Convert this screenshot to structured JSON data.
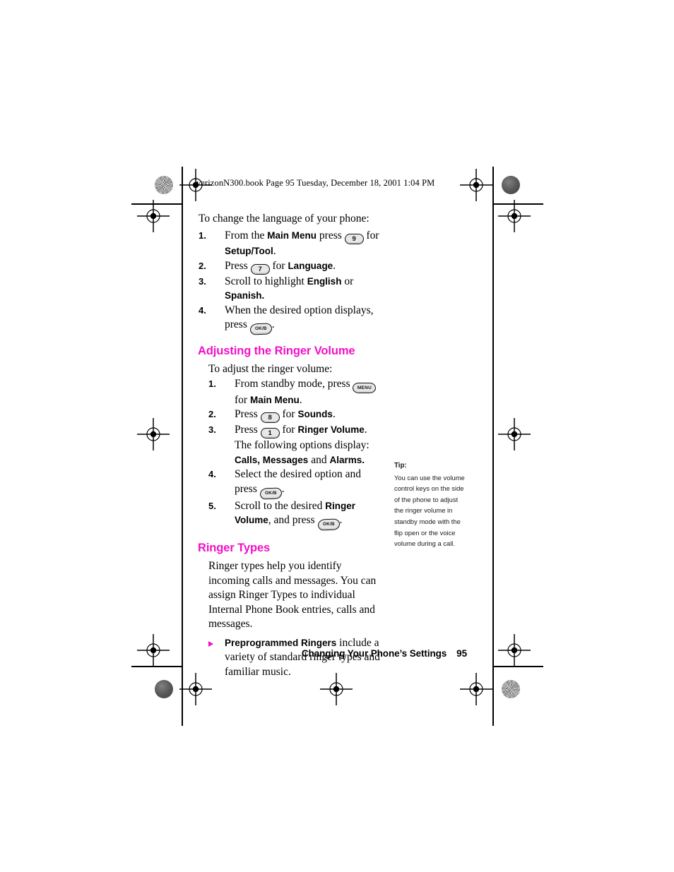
{
  "running_head": "verizonN300.book  Page 95  Tuesday, December 18, 2001  1:04 PM",
  "colors": {
    "heading_magenta": "#f210c8",
    "body_black": "#000000",
    "key_fill": "#e8e8e8"
  },
  "language_section": {
    "lead": "To change the language of your phone:",
    "steps": [
      {
        "num": "1.",
        "parts": [
          {
            "t": "text",
            "v": "From the "
          },
          {
            "t": "bold",
            "v": "Main Menu"
          },
          {
            "t": "text",
            "v": " press "
          },
          {
            "t": "key",
            "v": "9",
            "style": "num"
          },
          {
            "t": "text",
            "v": " for "
          },
          {
            "t": "bold",
            "v": "Setup/Tool"
          },
          {
            "t": "text",
            "v": "."
          }
        ]
      },
      {
        "num": "2.",
        "parts": [
          {
            "t": "text",
            "v": "Press "
          },
          {
            "t": "key",
            "v": "7",
            "style": "num"
          },
          {
            "t": "text",
            "v": " for "
          },
          {
            "t": "bold",
            "v": "Language"
          },
          {
            "t": "text",
            "v": "."
          }
        ]
      },
      {
        "num": "3.",
        "parts": [
          {
            "t": "text",
            "v": "Scroll to highlight "
          },
          {
            "t": "bold",
            "v": "English"
          },
          {
            "t": "text",
            "v": " or "
          },
          {
            "t": "bold",
            "v": "Spanish."
          }
        ]
      },
      {
        "num": "4.",
        "parts": [
          {
            "t": "text",
            "v": "When the desired option displays, press "
          },
          {
            "t": "key",
            "v": "OK/B",
            "style": "ok"
          },
          {
            "t": "text",
            "v": "."
          }
        ]
      }
    ]
  },
  "ringer_volume_section": {
    "heading": "Adjusting the Ringer Volume",
    "lead": "To adjust the ringer volume:",
    "steps": [
      {
        "num": "1.",
        "parts": [
          {
            "t": "text",
            "v": "From standby mode, press "
          },
          {
            "t": "key",
            "v": "MENU",
            "style": "menu"
          },
          {
            "t": "text",
            "v": " for "
          },
          {
            "t": "bold",
            "v": "Main Menu"
          },
          {
            "t": "text",
            "v": "."
          }
        ]
      },
      {
        "num": "2.",
        "parts": [
          {
            "t": "text",
            "v": "Press "
          },
          {
            "t": "key",
            "v": "8",
            "style": "num"
          },
          {
            "t": "text",
            "v": "  for "
          },
          {
            "t": "bold",
            "v": "Sounds"
          },
          {
            "t": "text",
            "v": "."
          }
        ]
      },
      {
        "num": "3.",
        "parts": [
          {
            "t": "text",
            "v": "Press "
          },
          {
            "t": "key",
            "v": "1",
            "style": "num"
          },
          {
            "t": "text",
            "v": " for "
          },
          {
            "t": "bold",
            "v": "Ringer Volume"
          },
          {
            "t": "text",
            "v": ". The following options display: "
          },
          {
            "t": "bold",
            "v": "Calls, Messages"
          },
          {
            "t": "text",
            "v": " and "
          },
          {
            "t": "bold",
            "v": "Alarms."
          }
        ]
      },
      {
        "num": "4.",
        "parts": [
          {
            "t": "text",
            "v": "Select the desired option and press "
          },
          {
            "t": "key",
            "v": "OK/B",
            "style": "ok"
          },
          {
            "t": "text",
            "v": "."
          }
        ]
      },
      {
        "num": "5.",
        "parts": [
          {
            "t": "text",
            "v": "Scroll to the desired "
          },
          {
            "t": "bold",
            "v": "Ringer Volume"
          },
          {
            "t": "text",
            "v": ", and press "
          },
          {
            "t": "key",
            "v": "OK/B",
            "style": "ok"
          },
          {
            "t": "text",
            "v": "."
          }
        ]
      }
    ]
  },
  "ringer_types_section": {
    "heading": "Ringer Types",
    "paragraph": "Ringer types help you identify incoming calls and messages. You can assign Ringer Types to individual Internal Phone Book entries, calls and messages.",
    "bullets": [
      {
        "parts": [
          {
            "t": "bold",
            "v": "Preprogrammed Ringers"
          },
          {
            "t": "text",
            "v": " include a variety of standard ringer types and familiar music."
          }
        ]
      }
    ]
  },
  "tip": {
    "label": "Tip:",
    "text": "You can use the volume control keys on the side of the phone to adjust the ringer volume in standby mode with the flip open or the voice volume during a call."
  },
  "footer": {
    "chapter": "Changing Your Phone’s Settings",
    "page_number": "95"
  }
}
